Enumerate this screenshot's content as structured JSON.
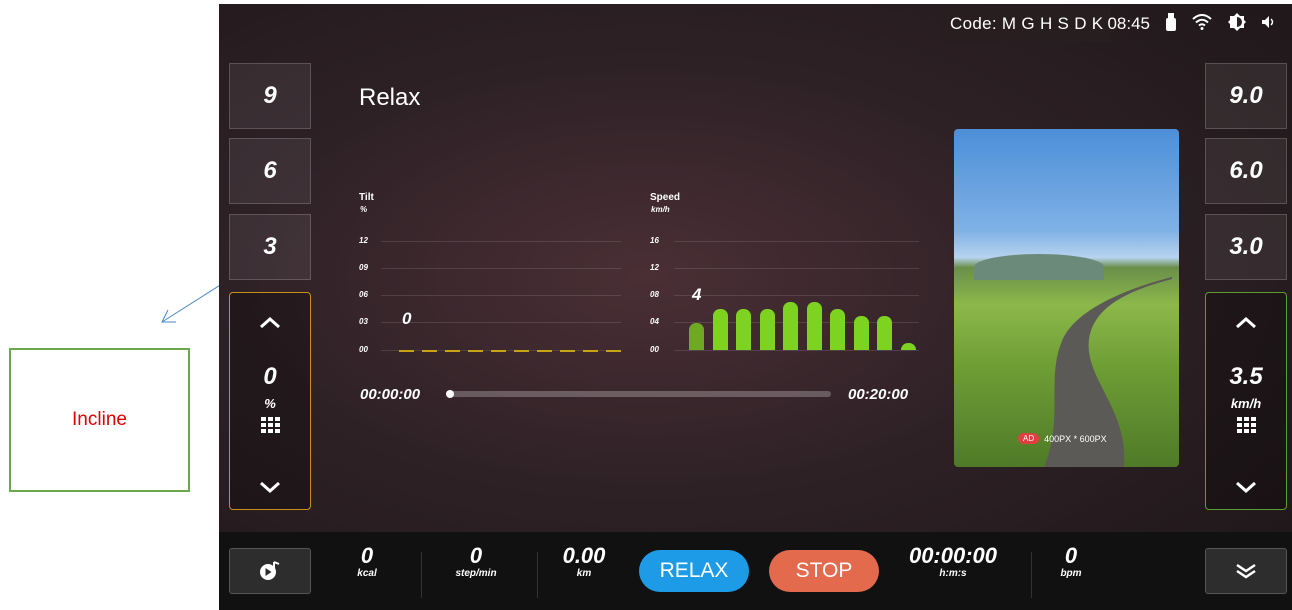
{
  "annotation": {
    "label": "Incline"
  },
  "status_bar": {
    "code": "Code: M G H S D K",
    "time": "08:45",
    "icons": [
      "usb-icon",
      "wifi-icon",
      "brightness-icon",
      "volume-icon"
    ]
  },
  "program": {
    "title": "Relax"
  },
  "left_presets": [
    "9",
    "6",
    "3"
  ],
  "right_presets": [
    "9.0",
    "6.0",
    "3.0"
  ],
  "incline_control": {
    "value": "0",
    "unit": "%",
    "accent": "#c98f1b"
  },
  "speed_control": {
    "value": "3.5",
    "unit": "km/h",
    "accent": "#5a9f2e"
  },
  "tilt_chart": {
    "title": "Tilt",
    "unit": "%",
    "ticks": [
      "12",
      "09",
      "06",
      "03",
      "00"
    ],
    "current_value": "0"
  },
  "speed_chart": {
    "title": "Speed",
    "unit": "km/h",
    "ticks": [
      "16",
      "12",
      "08",
      "04",
      "00"
    ],
    "current_value": "4"
  },
  "chart_data": [
    {
      "type": "bar",
      "title": "Tilt",
      "ylabel": "%",
      "ylim": [
        0,
        12
      ],
      "values": [
        0,
        0,
        0,
        0,
        0,
        0,
        0,
        0,
        0,
        0
      ],
      "color": "#c8a415"
    },
    {
      "type": "bar",
      "title": "Speed",
      "ylabel": "km/h",
      "ylim": [
        0,
        16
      ],
      "values": [
        4,
        6,
        6,
        6,
        7,
        7,
        6,
        5,
        5,
        1
      ],
      "color": "#7ed321"
    }
  ],
  "timeline": {
    "elapsed": "00:00:00",
    "total": "00:20:00",
    "progress": 0
  },
  "ad": {
    "tag": "AD",
    "size_text": "400PX * 600PX"
  },
  "bottom": {
    "calories": {
      "value": "0",
      "unit": "kcal"
    },
    "cadence": {
      "value": "0",
      "unit": "step/min"
    },
    "distance": {
      "value": "0.00",
      "unit": "km"
    },
    "relax_label": "RELAX",
    "stop_label": "STOP",
    "time": {
      "value": "00:00:00",
      "unit": "h:m:s"
    },
    "heart_rate": {
      "value": "0",
      "unit": "bpm"
    }
  },
  "colors": {
    "relax": "#1d9be6",
    "stop": "#e46a4e"
  }
}
